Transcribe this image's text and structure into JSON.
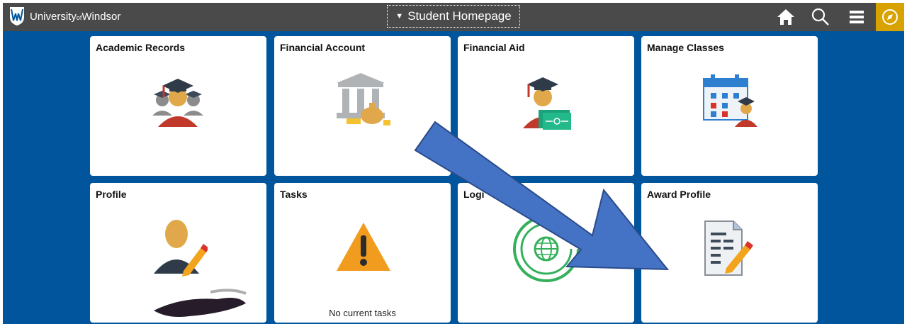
{
  "header": {
    "logo_text_main": "University",
    "logo_text_small": "of",
    "logo_text_end": "Windsor",
    "page_title": "Student Homepage",
    "icons": [
      "home-icon",
      "search-icon",
      "menu-icon",
      "compass-icon"
    ]
  },
  "tiles": [
    {
      "title": "Academic Records",
      "icon": "graduates-icon"
    },
    {
      "title": "Financial Account",
      "icon": "bank-money-icon"
    },
    {
      "title": "Financial Aid",
      "icon": "graduate-money-icon"
    },
    {
      "title": "Manage Classes",
      "icon": "calendar-student-icon"
    },
    {
      "title": "Profile",
      "icon": "profile-edit-icon"
    },
    {
      "title": "Tasks",
      "icon": "warning-icon",
      "subtext": "No current tasks"
    },
    {
      "title": "Logi",
      "icon": "globe-refresh-icon"
    },
    {
      "title": "Award Profile",
      "icon": "document-edit-icon"
    }
  ],
  "colors": {
    "background": "#00559c",
    "topbar": "#4a4a4a",
    "compass_accent": "#d8a300",
    "annotation_arrow": "#4472c4"
  }
}
